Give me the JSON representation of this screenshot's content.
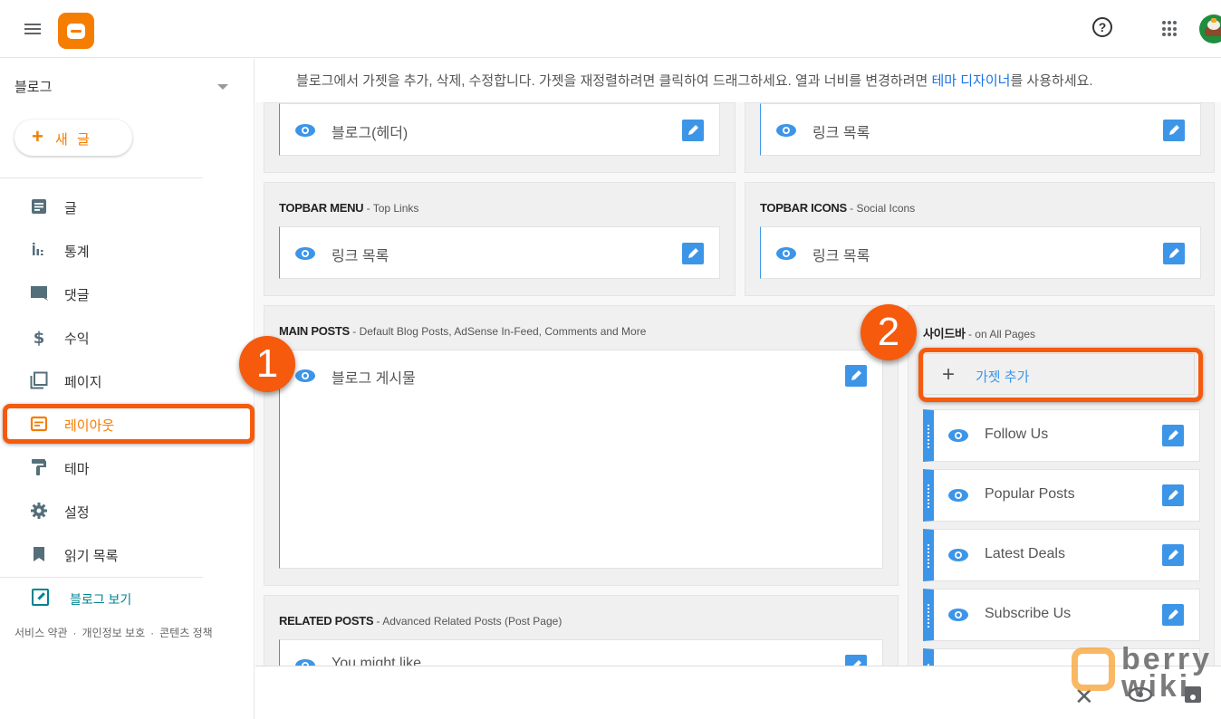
{
  "header": {
    "menu_icon": "hamburger-menu-icon",
    "logo_icon": "blogger-logo-icon",
    "help_icon": "help-circle-icon",
    "apps_icon": "apps-grid-icon",
    "avatar_icon": "user-avatar"
  },
  "sidebar": {
    "blog_name": "블로그",
    "new_post_label": "새 글",
    "items": [
      {
        "label": "글",
        "icon": "posts-icon",
        "active": false
      },
      {
        "label": "통계",
        "icon": "stats-icon",
        "active": false
      },
      {
        "label": "댓글",
        "icon": "comments-icon",
        "active": false
      },
      {
        "label": "수익",
        "icon": "dollar-icon",
        "active": false
      },
      {
        "label": "페이지",
        "icon": "pages-icon",
        "active": false
      },
      {
        "label": "레이아웃",
        "icon": "layout-icon",
        "active": true
      },
      {
        "label": "테마",
        "icon": "paint-roller-icon",
        "active": false
      },
      {
        "label": "설정",
        "icon": "gear-icon",
        "active": false
      },
      {
        "label": "읽기 목록",
        "icon": "bookmark-icon",
        "active": false
      }
    ],
    "view_blog_label": "블로그 보기",
    "footer_links": [
      "서비스 약관",
      "개인정보 보호",
      "콘텐츠 정책"
    ]
  },
  "main": {
    "intro_prefix": "블로그에서 가젯을 추가, 삭제, 수정합니다. 가젯을 재정렬하려면 클릭하여 드래그하세요. 열과 너비를 변경하려면 ",
    "intro_link": "테마 디자이너",
    "intro_suffix": "를 사용하세요.",
    "sections": {
      "header_left": {
        "widget": "블로그(헤더)"
      },
      "header_right": {
        "widget": "링크 목록"
      },
      "topbar_menu": {
        "title": "TOPBAR MENU",
        "subtitle": " - Top Links",
        "widget": "링크 목록"
      },
      "topbar_icons": {
        "title": "TOPBAR ICONS",
        "subtitle": " - Social Icons",
        "widget": "링크 목록"
      },
      "main_posts": {
        "title": "MAIN POSTS",
        "subtitle": " - Default Blog Posts, AdSense In-Feed, Comments and More",
        "widget": "블로그 게시물"
      },
      "related_posts": {
        "title": "RELATED POSTS",
        "subtitle": " - Advanced Related Posts (Post Page)",
        "widget": "You might like"
      },
      "sidebar": {
        "title": "사이드바",
        "subtitle": " - on All Pages",
        "add_gadget_label": "가젯 추가",
        "widgets": [
          "Follow Us",
          "Popular Posts",
          "Latest Deals",
          "Subscribe Us"
        ]
      }
    }
  },
  "annotations": {
    "badge_1": "1",
    "badge_2": "2"
  },
  "bottombar": {
    "close_icon": "close-icon",
    "preview_icon": "eye-icon",
    "save_icon": "save-icon"
  },
  "watermark": {
    "line1": "berry",
    "line2": "wiki"
  },
  "colors": {
    "accent": "#f57d00",
    "highlight": "#f55a0d",
    "link_blue": "#1a73e8",
    "widget_blue": "#3d95e8",
    "teal": "#00838f"
  }
}
